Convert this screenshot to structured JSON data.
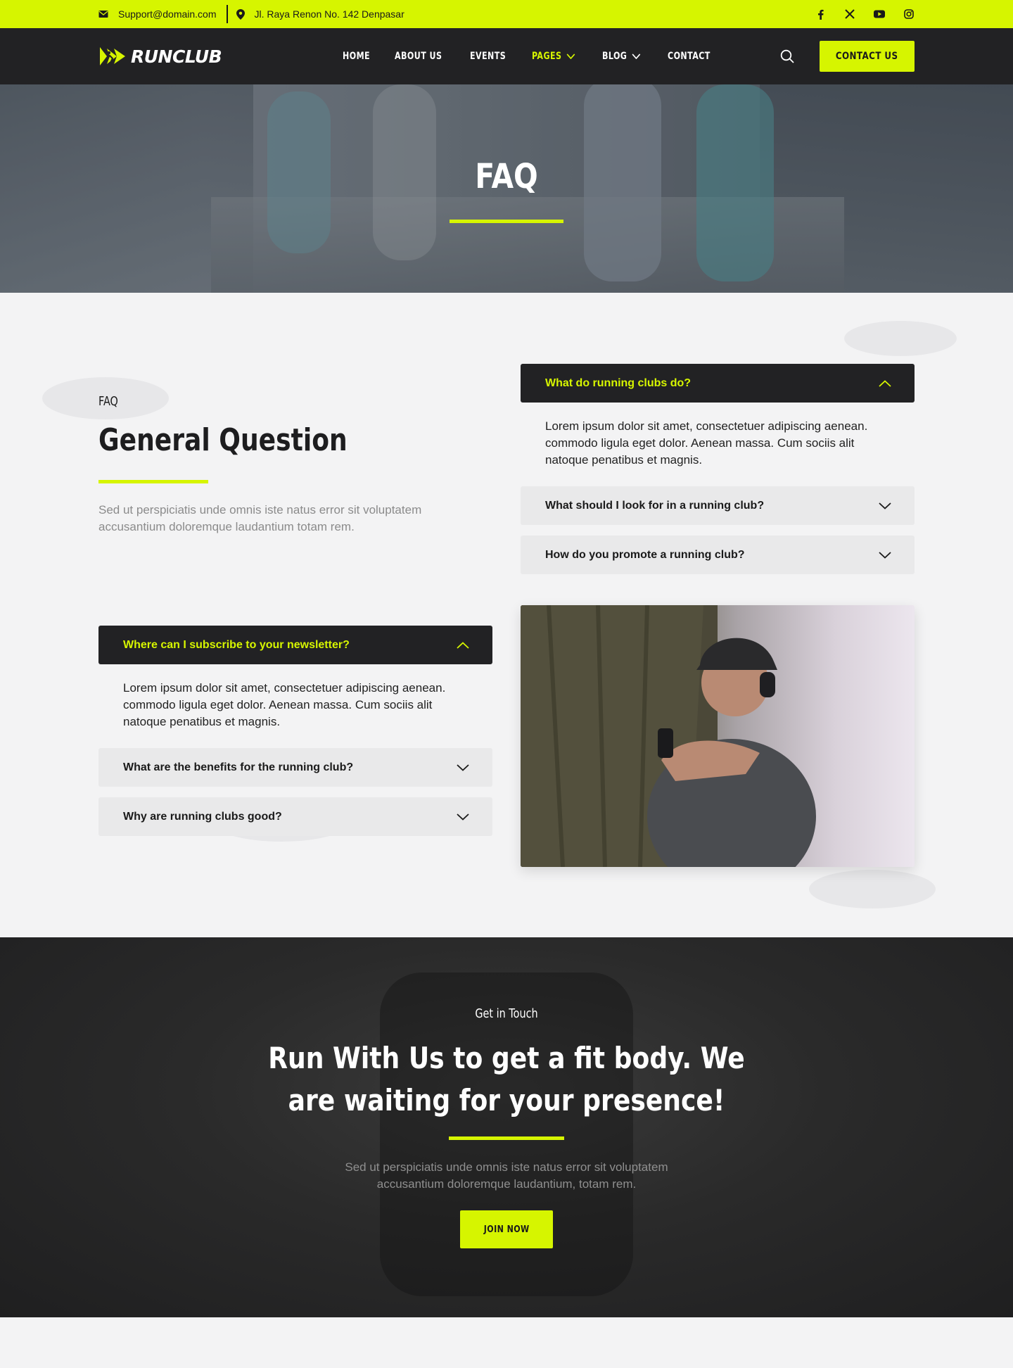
{
  "topbar": {
    "email": "Support@domain.com",
    "address": "Jl. Raya Renon No. 142 Denpasar",
    "socials": [
      "facebook-icon",
      "x-icon",
      "youtube-icon",
      "instagram-icon"
    ]
  },
  "nav": {
    "logo": "RUNCLUB",
    "items": [
      {
        "label": "HOME"
      },
      {
        "label": "ABOUT US"
      },
      {
        "label": "EVENTS"
      },
      {
        "label": "PAGES"
      },
      {
        "label": "BLOG"
      },
      {
        "label": "CONTACT"
      }
    ],
    "cta_label": "CONTACT US"
  },
  "hero": {
    "title": "FAQ"
  },
  "faq": {
    "eyebrow": "FAQ",
    "title": "General Question",
    "lead": "Sed ut perspiciatis unde omnis iste natus error sit voluptatem accusantium doloremque laudantium totam rem.",
    "right_items": [
      {
        "question": "What do running clubs do?",
        "answer": "Lorem ipsum dolor sit amet, consectetuer adipiscing aenean. commodo ligula eget dolor. Aenean massa. Cum sociis alit natoque penatibus et magnis."
      },
      {
        "question": "What should I look for in a running club?"
      },
      {
        "question": "How do you promote a running club?"
      }
    ],
    "left_items": [
      {
        "question": "Where can I subscribe to your newsletter?",
        "answer": "Lorem ipsum dolor sit amet, consectetuer adipiscing aenean. commodo ligula eget dolor. Aenean massa. Cum sociis alit natoque penatibus et magnis."
      },
      {
        "question": "What are the benefits for the running club?"
      },
      {
        "question": "Why are running clubs good?"
      }
    ]
  },
  "cta": {
    "eyebrow": "Get in Touch",
    "title": "Run With Us to get a fit body. We are waiting for your presence!",
    "text": "Sed ut perspiciatis unde omnis iste natus error sit voluptatem accusantium doloremque laudantium, totam rem.",
    "button": "JOIN NOW"
  },
  "colors": {
    "accent": "#d6f500",
    "dark": "#222224"
  }
}
